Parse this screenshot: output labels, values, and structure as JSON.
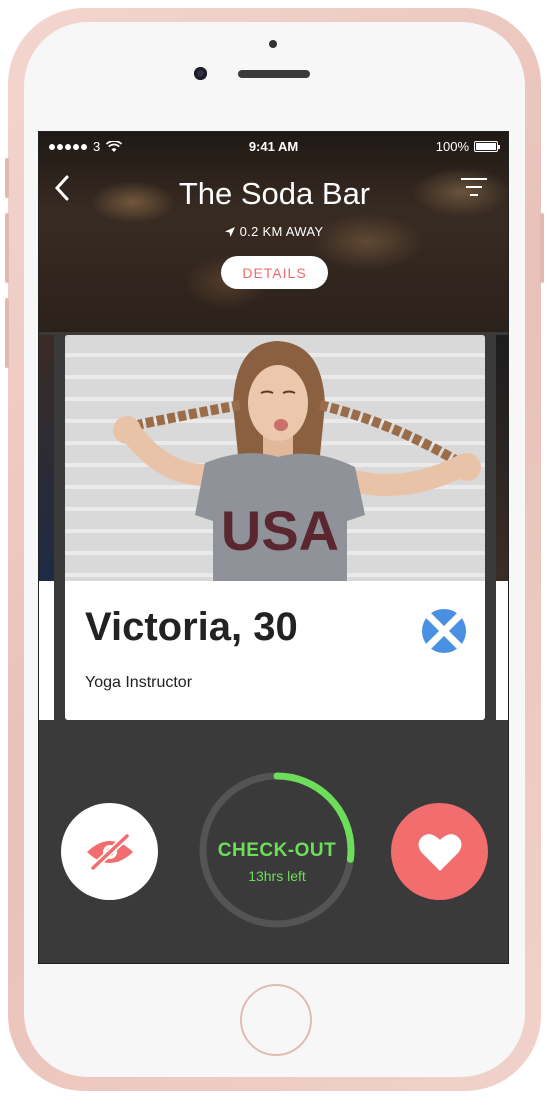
{
  "status_bar": {
    "carrier": "3",
    "time": "9:41 AM",
    "battery": "100%"
  },
  "header": {
    "title": "The Soda Bar",
    "distance": "0.2 KM AWAY",
    "details_label": "DETAILS"
  },
  "profile": {
    "name": "Victoria, 30",
    "occupation": "Yoga Instructor",
    "photo_shirt_text": "USA"
  },
  "actions": {
    "checkout_label": "CHECK-OUT",
    "checkout_time": "13hrs left",
    "checkout_progress": 0.27
  },
  "colors": {
    "accent": "#f26d6d",
    "progress": "#6dde5a",
    "flag_blue": "#4a90e2",
    "screen_bg": "#3a3a3a"
  },
  "icons": [
    "back-chevron-icon",
    "filter-icon",
    "location-arrow-icon",
    "hide-eye-icon",
    "heart-icon",
    "wifi-icon",
    "battery-icon"
  ]
}
